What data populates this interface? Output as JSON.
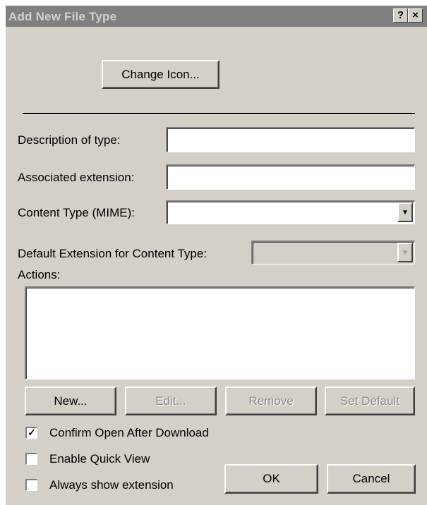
{
  "window": {
    "title": "Add New File Type",
    "help_button": "?",
    "close_button": "×"
  },
  "change_icon_button": "Change Icon...",
  "fields": {
    "description_label": "Description of type:",
    "description_value": "",
    "extension_label": "Associated extension:",
    "extension_value": "",
    "content_type_label": "Content Type (MIME):",
    "content_type_value": "",
    "default_ext_label": "Default Extension for Content Type:",
    "default_ext_value": ""
  },
  "actions": {
    "label": "Actions:",
    "items": []
  },
  "action_buttons": {
    "new": "New...",
    "edit": "Edit...",
    "remove": "Remove",
    "set_default": "Set Default"
  },
  "options": {
    "confirm_open": {
      "label": "Confirm Open After Download",
      "checked": true
    },
    "quick_view": {
      "label": "Enable Quick View",
      "checked": false
    },
    "always_show_ext": {
      "label": "Always show extension",
      "checked": false
    }
  },
  "footer": {
    "ok": "OK",
    "cancel": "Cancel"
  },
  "colors": {
    "face": "#d4d0c8",
    "titlebar_inactive": "#808080",
    "title_text": "#d4d0c8"
  }
}
